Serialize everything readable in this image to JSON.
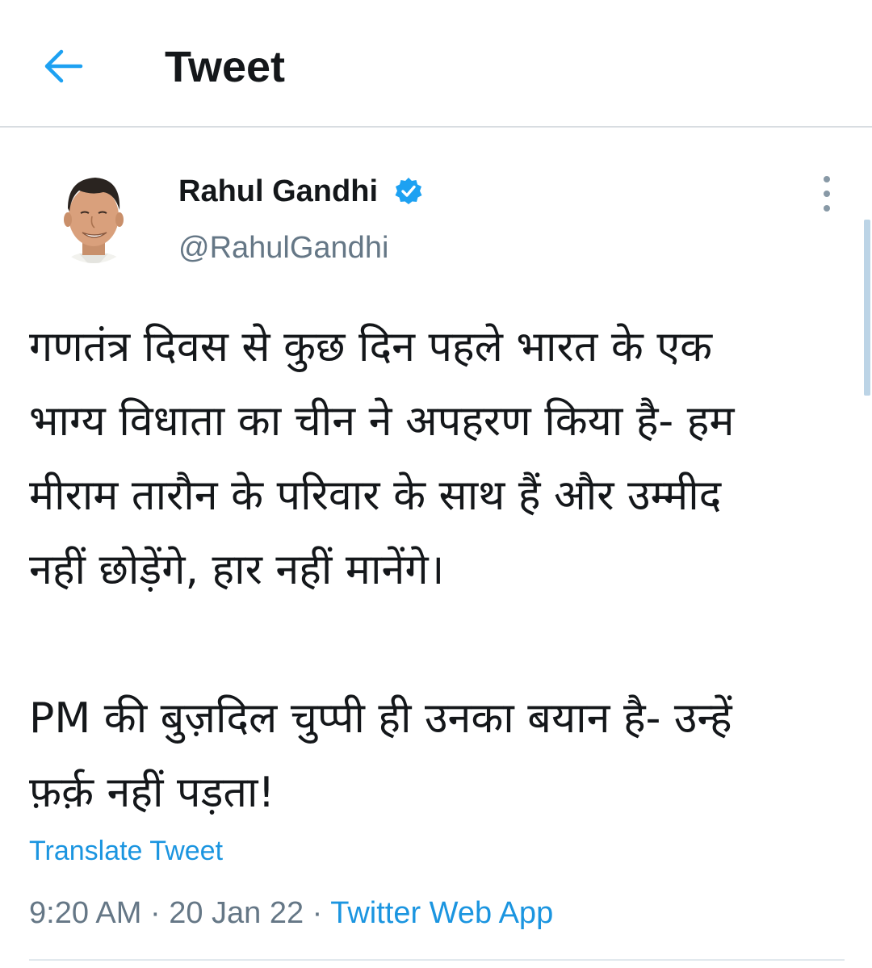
{
  "header": {
    "back_icon": "arrow-left-icon",
    "title": "Tweet"
  },
  "tweet": {
    "author": {
      "name": "Rahul Gandhi",
      "handle": "@RahulGandhi",
      "verified": true,
      "verified_icon": "verified-badge-icon"
    },
    "more_icon": "more-vertical-icon",
    "text_lines": [
      "गणतंत्र दिवस से कुछ दिन पहले भारत के एक",
      "भाग्य विधाता का चीन ने अपहरण किया है- हम",
      "मीराम तारौन के परिवार के साथ हैं और उम्मीद",
      "नहीं छोड़ेंगे, हार नहीं मानेंगे।",
      "PM की बुज़दिल चुप्पी ही उनका बयान है- उन्हें",
      "फ़र्क़ नहीं पड़ता!"
    ],
    "translate_label": "Translate Tweet",
    "time": "9:20 AM",
    "date": "20 Jan 22",
    "separator": " · ",
    "source": "Twitter Web App"
  },
  "colors": {
    "accent": "#1da1f2",
    "link": "#1b95e0",
    "secondary_text": "#657786",
    "divider": "#d8dde1"
  }
}
